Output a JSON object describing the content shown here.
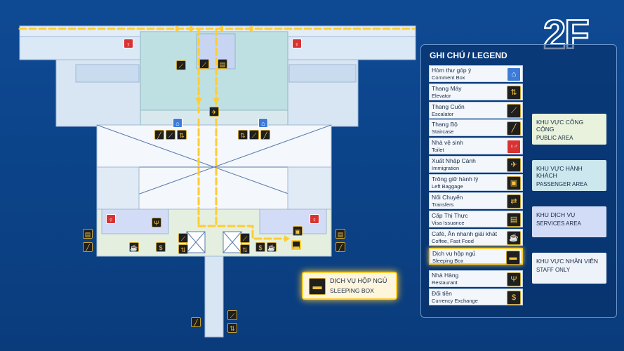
{
  "floor_label": "2F",
  "legend": {
    "title": "GHI CHÚ / LEGEND",
    "items": [
      {
        "vi": "Hòm thư góp ý",
        "en": "Comment Box",
        "icon": "comment-box-icon",
        "glyph": "⌂"
      },
      {
        "vi": "Thang Máy",
        "en": "Elevator",
        "icon": "elevator-icon",
        "glyph": "⇅"
      },
      {
        "vi": "Thang Cuốn",
        "en": "Escalator",
        "icon": "escalator-icon",
        "glyph": "⟋"
      },
      {
        "vi": "Thang Bộ",
        "en": "Staircase",
        "icon": "staircase-icon",
        "glyph": "╱"
      },
      {
        "vi": "Nhà vệ sinh",
        "en": "Toilet",
        "icon": "toilet-icon",
        "glyph": "♀♂"
      },
      {
        "vi": "Xuất Nhập Cảnh",
        "en": "Immigration",
        "icon": "immigration-icon",
        "glyph": "✈"
      },
      {
        "vi": "Trông giữ hành lý",
        "en": "Left Baggage",
        "icon": "baggage-icon",
        "glyph": "▣"
      },
      {
        "vi": "Nối Chuyến",
        "en": "Transfers",
        "icon": "transfers-icon",
        "glyph": "⇄"
      },
      {
        "vi": "Cấp Thị Thực",
        "en": "Visa Issuance",
        "icon": "visa-icon",
        "glyph": "▤"
      },
      {
        "vi": "Café, Ăn nhanh giải khát",
        "en": "Coffee, Fast Food",
        "icon": "coffee-icon",
        "glyph": "☕"
      },
      {
        "vi": "Dịch vụ hộp ngủ",
        "en": "Sleeping Box",
        "icon": "sleeping-box-icon",
        "glyph": "▬"
      },
      {
        "vi": "Nhà Hàng",
        "en": "Restaurant",
        "icon": "restaurant-icon",
        "glyph": "Ψ"
      },
      {
        "vi": "Đổi tiền",
        "en": "Currency Exchange",
        "icon": "currency-exchange-icon",
        "glyph": "$"
      }
    ],
    "highlighted_item": "Sleeping Box"
  },
  "areas": [
    {
      "vi": "KHU VỰC CÔNG CỘNG",
      "en": "PUBLIC AREA",
      "color": "#e8f2dc"
    },
    {
      "vi": "KHU VỰC HÀNH KHÁCH",
      "en": "PASSENGER AREA",
      "color": "#cce7ee"
    },
    {
      "vi": "KHU DỊCH VỤ",
      "en": "SERVICES AREA",
      "color": "#d3dcf6"
    },
    {
      "vi": "KHU VỰC NHÂN VIÊN",
      "en": "STAFF ONLY",
      "color": "#eef2f9"
    }
  ],
  "callout": {
    "vi": "DỊCH VỤ HỘP NGỦ",
    "en": "SLEEPING BOX",
    "icon": "sleeping-box-icon"
  },
  "colors": {
    "background": "#0b3f82",
    "route": "#ffcc33",
    "public_area": "#e8f2dc",
    "passenger_area": "#cce7ee",
    "services_area": "#d3dcf6",
    "staff_area": "#eef2f9",
    "icon_gold": "#f3c33a"
  }
}
